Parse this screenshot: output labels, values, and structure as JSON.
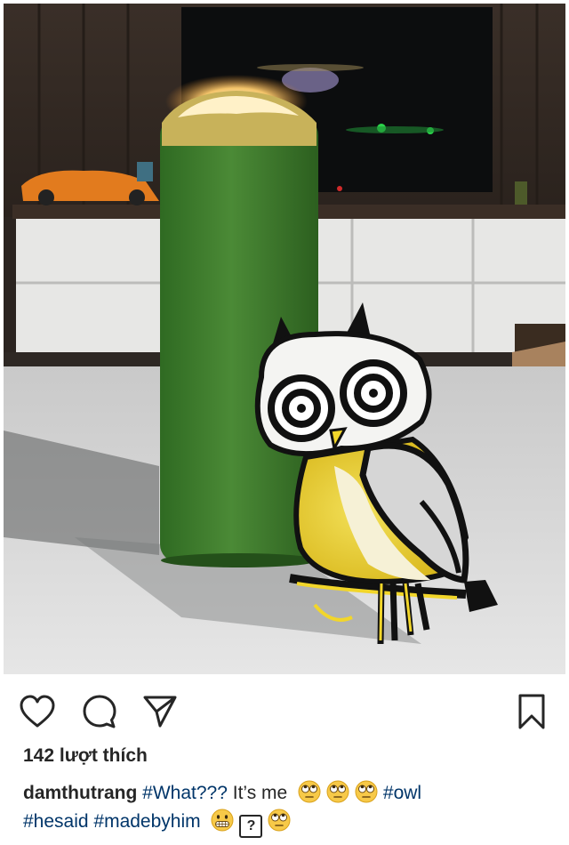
{
  "post": {
    "likes_text": "142 lượt thích",
    "caption": {
      "username": "damthutrang",
      "hashtag_what": "#What???",
      "text": " It’s me",
      "hashtag_owl": "#owl",
      "hashtag_hesaid": "#hesaid",
      "hashtag_madebyhim": "#madebyhim",
      "unknown_glyph": "?"
    },
    "emoji": {
      "eye_roll": "rolling-eyes-face",
      "grimace": "grimacing-face"
    }
  },
  "icons": {
    "like": "heart-icon",
    "comment": "comment-bubble-icon",
    "share": "paper-plane-icon",
    "save": "bookmark-icon"
  },
  "colors": {
    "text": "#262626",
    "hashtag": "#003569",
    "candle_green": "#3d7a2c",
    "owl_yellow": "#f2d62a"
  }
}
